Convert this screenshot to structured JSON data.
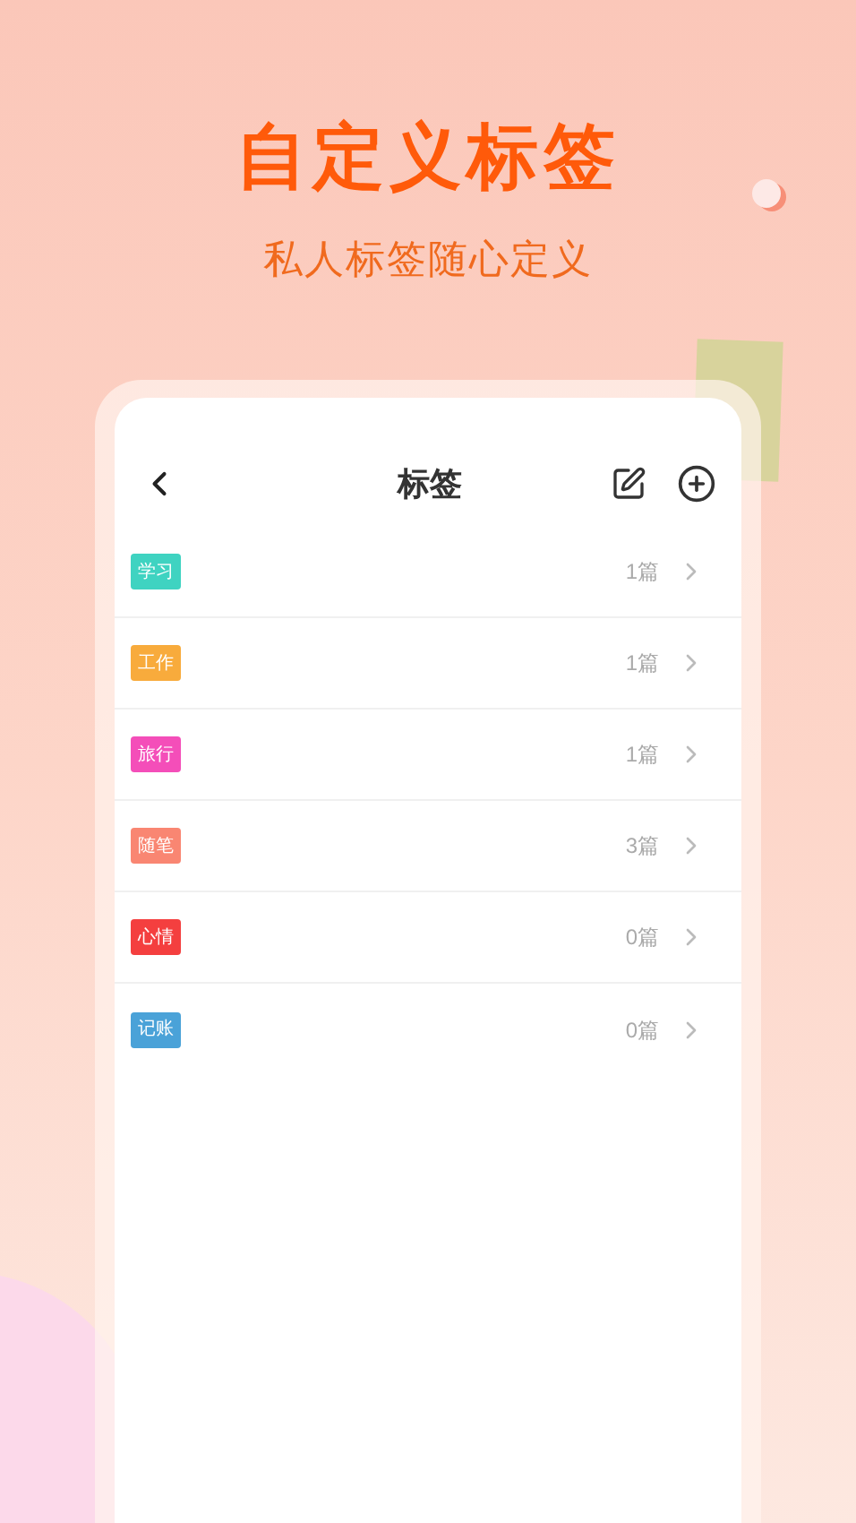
{
  "hero": {
    "title": "自定义标签",
    "subtitle": "私人标签随心定义"
  },
  "header": {
    "title": "标签"
  },
  "tags": [
    {
      "label": "学习",
      "color": "#3fd3c1",
      "count": "1篇"
    },
    {
      "label": "工作",
      "color": "#f8ab3c",
      "count": "1篇"
    },
    {
      "label": "旅行",
      "color": "#f44eb9",
      "count": "1篇"
    },
    {
      "label": "随笔",
      "color": "#f98672",
      "count": "3篇"
    },
    {
      "label": "心情",
      "color": "#f43f3f",
      "count": "0篇"
    },
    {
      "label": "记账",
      "color": "#4aa2d8",
      "count": "0篇"
    }
  ]
}
